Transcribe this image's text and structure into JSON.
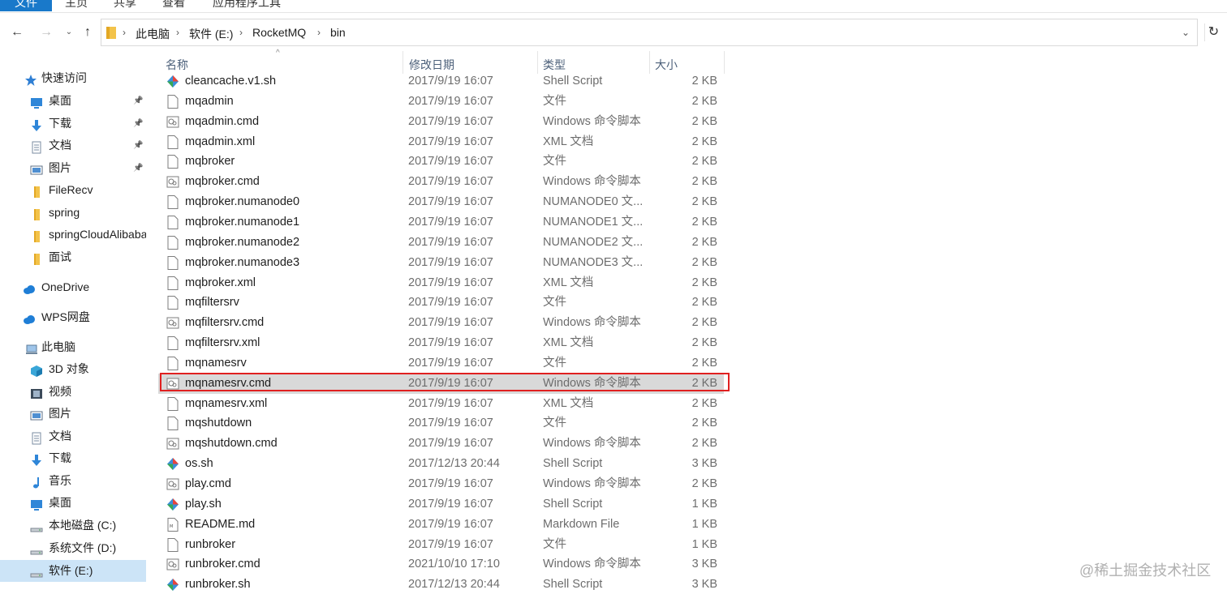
{
  "ribbon": {
    "tabs": [
      "文件",
      "主页",
      "共享",
      "查看",
      "应用程序工具"
    ]
  },
  "address": {
    "crumbs": [
      "此电脑",
      "软件 (E:)",
      "RocketMQ",
      "bin"
    ]
  },
  "sidebar": {
    "items": [
      {
        "label": "快速访问",
        "icon": "star-icon",
        "pinned": false
      },
      {
        "label": "桌面",
        "icon": "desktop-icon",
        "pinned": true
      },
      {
        "label": "下载",
        "icon": "download-icon",
        "pinned": true
      },
      {
        "label": "文档",
        "icon": "document-icon",
        "pinned": true
      },
      {
        "label": "图片",
        "icon": "picture-icon",
        "pinned": true
      },
      {
        "label": "FileRecv",
        "icon": "folder-icon",
        "pinned": false
      },
      {
        "label": "spring",
        "icon": "folder-icon",
        "pinned": false
      },
      {
        "label": "springCloudAlibaba",
        "icon": "folder-icon",
        "pinned": false
      },
      {
        "label": "面试",
        "icon": "folder-icon",
        "pinned": false
      },
      {
        "label": "OneDrive",
        "icon": "cloud-icon",
        "pinned": false
      },
      {
        "label": "WPS网盘",
        "icon": "cloud-icon",
        "pinned": false
      },
      {
        "label": "此电脑",
        "icon": "computer-icon",
        "pinned": false
      },
      {
        "label": "3D 对象",
        "icon": "cube-icon",
        "pinned": false
      },
      {
        "label": "视频",
        "icon": "video-icon",
        "pinned": false
      },
      {
        "label": "图片",
        "icon": "picture-icon",
        "pinned": false
      },
      {
        "label": "文档",
        "icon": "document-icon",
        "pinned": false
      },
      {
        "label": "下载",
        "icon": "download-icon",
        "pinned": false
      },
      {
        "label": "音乐",
        "icon": "music-icon",
        "pinned": false
      },
      {
        "label": "桌面",
        "icon": "desktop-icon",
        "pinned": false
      },
      {
        "label": "本地磁盘 (C:)",
        "icon": "drive-icon",
        "pinned": false
      },
      {
        "label": "系统文件 (D:)",
        "icon": "drive-icon",
        "pinned": false
      },
      {
        "label": "软件 (E:)",
        "icon": "drive-icon",
        "pinned": false,
        "selected": true
      }
    ]
  },
  "columns": {
    "name": "名称",
    "date": "修改日期",
    "type": "类型",
    "size": "大小"
  },
  "files": [
    {
      "name": "cleancache.v1.sh",
      "date": "2017/9/19 16:07",
      "type": "Shell Script",
      "size": "2 KB",
      "icon": "shell-script-icon"
    },
    {
      "name": "mqadmin",
      "date": "2017/9/19 16:07",
      "type": "文件",
      "size": "2 KB",
      "icon": "file-icon"
    },
    {
      "name": "mqadmin.cmd",
      "date": "2017/9/19 16:07",
      "type": "Windows 命令脚本",
      "size": "2 KB",
      "icon": "cmd-script-icon"
    },
    {
      "name": "mqadmin.xml",
      "date": "2017/9/19 16:07",
      "type": "XML 文档",
      "size": "2 KB",
      "icon": "file-icon"
    },
    {
      "name": "mqbroker",
      "date": "2017/9/19 16:07",
      "type": "文件",
      "size": "2 KB",
      "icon": "file-icon"
    },
    {
      "name": "mqbroker.cmd",
      "date": "2017/9/19 16:07",
      "type": "Windows 命令脚本",
      "size": "2 KB",
      "icon": "cmd-script-icon"
    },
    {
      "name": "mqbroker.numanode0",
      "date": "2017/9/19 16:07",
      "type": "NUMANODE0 文...",
      "size": "2 KB",
      "icon": "file-icon"
    },
    {
      "name": "mqbroker.numanode1",
      "date": "2017/9/19 16:07",
      "type": "NUMANODE1 文...",
      "size": "2 KB",
      "icon": "file-icon"
    },
    {
      "name": "mqbroker.numanode2",
      "date": "2017/9/19 16:07",
      "type": "NUMANODE2 文...",
      "size": "2 KB",
      "icon": "file-icon"
    },
    {
      "name": "mqbroker.numanode3",
      "date": "2017/9/19 16:07",
      "type": "NUMANODE3 文...",
      "size": "2 KB",
      "icon": "file-icon"
    },
    {
      "name": "mqbroker.xml",
      "date": "2017/9/19 16:07",
      "type": "XML 文档",
      "size": "2 KB",
      "icon": "file-icon"
    },
    {
      "name": "mqfiltersrv",
      "date": "2017/9/19 16:07",
      "type": "文件",
      "size": "2 KB",
      "icon": "file-icon"
    },
    {
      "name": "mqfiltersrv.cmd",
      "date": "2017/9/19 16:07",
      "type": "Windows 命令脚本",
      "size": "2 KB",
      "icon": "cmd-script-icon"
    },
    {
      "name": "mqfiltersrv.xml",
      "date": "2017/9/19 16:07",
      "type": "XML 文档",
      "size": "2 KB",
      "icon": "file-icon"
    },
    {
      "name": "mqnamesrv",
      "date": "2017/9/19 16:07",
      "type": "文件",
      "size": "2 KB",
      "icon": "file-icon"
    },
    {
      "name": "mqnamesrv.cmd",
      "date": "2017/9/19 16:07",
      "type": "Windows 命令脚本",
      "size": "2 KB",
      "icon": "cmd-script-icon",
      "highlighted": true
    },
    {
      "name": "mqnamesrv.xml",
      "date": "2017/9/19 16:07",
      "type": "XML 文档",
      "size": "2 KB",
      "icon": "file-icon"
    },
    {
      "name": "mqshutdown",
      "date": "2017/9/19 16:07",
      "type": "文件",
      "size": "2 KB",
      "icon": "file-icon"
    },
    {
      "name": "mqshutdown.cmd",
      "date": "2017/9/19 16:07",
      "type": "Windows 命令脚本",
      "size": "2 KB",
      "icon": "cmd-script-icon"
    },
    {
      "name": "os.sh",
      "date": "2017/12/13 20:44",
      "type": "Shell Script",
      "size": "3 KB",
      "icon": "shell-script-icon"
    },
    {
      "name": "play.cmd",
      "date": "2017/9/19 16:07",
      "type": "Windows 命令脚本",
      "size": "2 KB",
      "icon": "cmd-script-icon"
    },
    {
      "name": "play.sh",
      "date": "2017/9/19 16:07",
      "type": "Shell Script",
      "size": "1 KB",
      "icon": "shell-script-icon"
    },
    {
      "name": "README.md",
      "date": "2017/9/19 16:07",
      "type": "Markdown File",
      "size": "1 KB",
      "icon": "markdown-icon"
    },
    {
      "name": "runbroker",
      "date": "2017/9/19 16:07",
      "type": "文件",
      "size": "1 KB",
      "icon": "file-icon"
    },
    {
      "name": "runbroker.cmd",
      "date": "2021/10/10 17:10",
      "type": "Windows 命令脚本",
      "size": "3 KB",
      "icon": "cmd-script-icon"
    },
    {
      "name": "runbroker.sh",
      "date": "2017/12/13 20:44",
      "type": "Shell Script",
      "size": "3 KB",
      "icon": "shell-script-icon"
    }
  ],
  "watermark": "@稀土掘金技术社区",
  "colors": {
    "accent": "#1979ca",
    "selection": "#cce4f7",
    "highlight_box": "#e02020"
  }
}
